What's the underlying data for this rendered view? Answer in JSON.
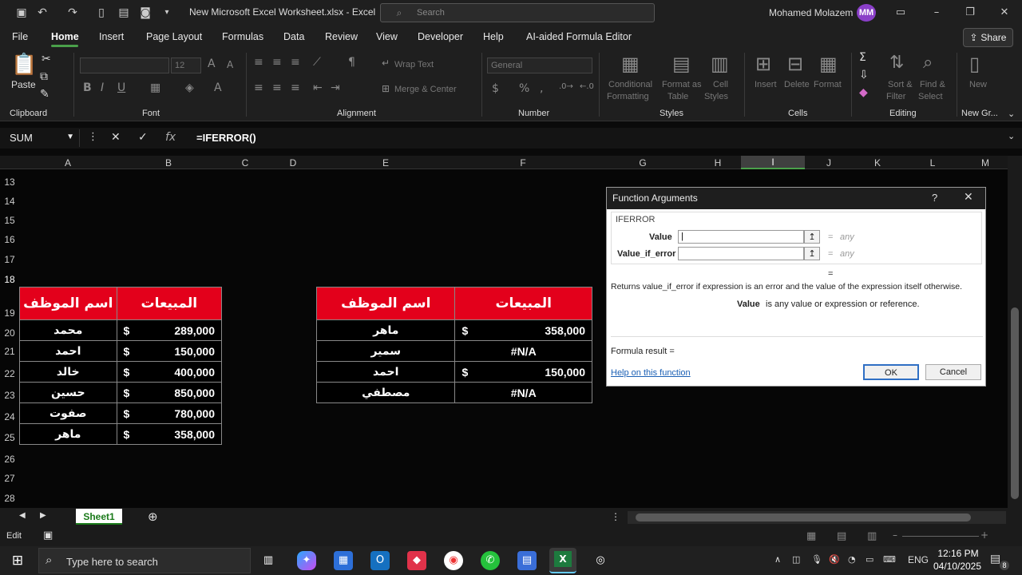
{
  "titlebar": {
    "filename": "New Microsoft Excel Worksheet.xlsx  -  Excel",
    "search_placeholder": "Search",
    "user": "Mohamed Molazem",
    "initials": "MM"
  },
  "menu": [
    "File",
    "Home",
    "Insert",
    "Page Layout",
    "Formulas",
    "Data",
    "Review",
    "View",
    "Developer",
    "Help",
    "AI-aided Formula Editor"
  ],
  "share_label": "Share",
  "ribbon": {
    "paste": "Paste",
    "font_size": "12",
    "wrap_text": "Wrap Text",
    "merge_center": "Merge & Center",
    "number_format": "General",
    "cond_format": [
      "Conditional",
      "Formatting"
    ],
    "format_table": [
      "Format as",
      "Table"
    ],
    "cell_styles": [
      "Cell",
      "Styles"
    ],
    "insert": "Insert",
    "delete": "Delete",
    "format": "Format",
    "sort_filter": [
      "Sort &",
      "Filter"
    ],
    "find_select": [
      "Find &",
      "Select"
    ],
    "new": "New",
    "groups": [
      "Clipboard",
      "Font",
      "Alignment",
      "Number",
      "Styles",
      "Cells",
      "Editing",
      "New Gr..."
    ]
  },
  "formula_bar": {
    "name_box": "SUM",
    "formula": "=IFERROR()"
  },
  "columns": [
    "A",
    "B",
    "C",
    "D",
    "E",
    "F",
    "G",
    "H",
    "I",
    "J",
    "K",
    "L",
    "M"
  ],
  "rows": [
    "13",
    "14",
    "15",
    "16",
    "17",
    "18",
    "19",
    "20",
    "21",
    "22",
    "23",
    "24",
    "25",
    "26",
    "27",
    "28"
  ],
  "table1": {
    "headers": [
      "اسم الموظف",
      "المبيعات"
    ],
    "rows": [
      {
        "name": "محمد",
        "cur": "$",
        "amount": "289,000"
      },
      {
        "name": "احمد",
        "cur": "$",
        "amount": "150,000"
      },
      {
        "name": "خالد",
        "cur": "$",
        "amount": "400,000"
      },
      {
        "name": "حسين",
        "cur": "$",
        "amount": "850,000"
      },
      {
        "name": "صفوت",
        "cur": "$",
        "amount": "780,000"
      },
      {
        "name": "ماهر",
        "cur": "$",
        "amount": "358,000"
      }
    ]
  },
  "table2": {
    "headers": [
      "اسم الموظف",
      "المبيعات"
    ],
    "rows": [
      {
        "name": "ماهر",
        "cur": "$",
        "amount": "358,000"
      },
      {
        "name": "سمير",
        "value": "#N/A"
      },
      {
        "name": "احمد",
        "cur": "$",
        "amount": "150,000"
      },
      {
        "name": "مصطفي",
        "value": "#N/A"
      }
    ]
  },
  "dialog": {
    "title": "Function Arguments",
    "help_q": "?",
    "function": "IFERROR",
    "arg1_label": "Value",
    "arg2_label": "Value_if_error",
    "any": "any",
    "eq": "=",
    "description": "Returns value_if_error if expression is an error and the value of the expression itself otherwise.",
    "arg_help_name": "Value",
    "arg_help_text": "is any value or expression or reference.",
    "formula_result": "Formula result =",
    "help_link": "Help on this function",
    "ok": "OK",
    "cancel": "Cancel"
  },
  "sheet_tab": "Sheet1",
  "status": "Edit",
  "taskbar": {
    "search": "Type here to search",
    "time": "12:16 PM",
    "date": "04/10/2025",
    "lang": "ENG",
    "notif": "8"
  }
}
